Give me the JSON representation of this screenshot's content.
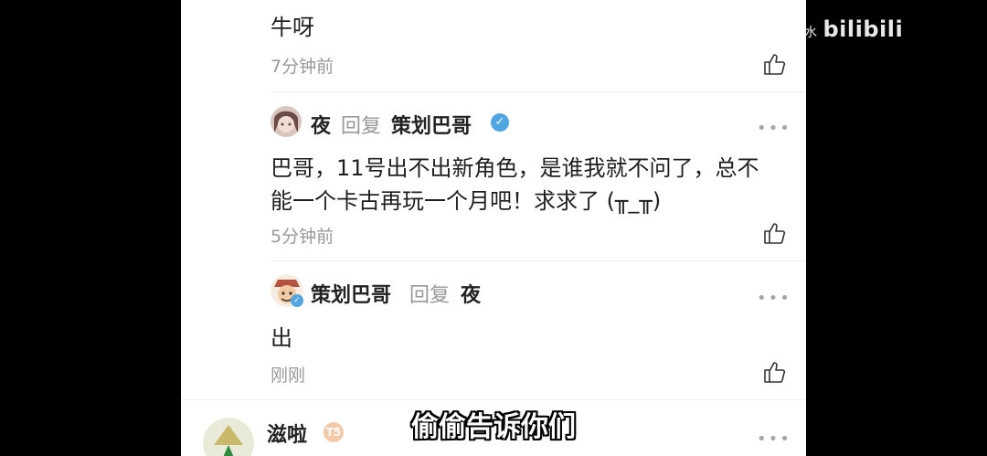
{
  "watermark": {
    "prefix": "水",
    "brand": "bilibili"
  },
  "comment_top": {
    "text": "牛呀",
    "time": "7分钟前"
  },
  "reply1": {
    "user": "夜",
    "reply_word": "回复",
    "target": "策划巴哥",
    "text_line1": "巴哥，11号出不出新角色，是谁我就不问了，总不",
    "text_line2": "能一个卡古再玩一个月吧！求求了 (╥_╥)",
    "time": "5分钟前"
  },
  "reply2": {
    "user": "策划巴哥",
    "reply_word": "回复",
    "target": "夜",
    "text": "出",
    "time": "刚刚"
  },
  "comment_bottom": {
    "user": "滋啦",
    "level": "T5"
  },
  "subtitle": "偷偷告诉你们",
  "colors": {
    "verified": "#4fa6e0",
    "meta": "#999999"
  }
}
